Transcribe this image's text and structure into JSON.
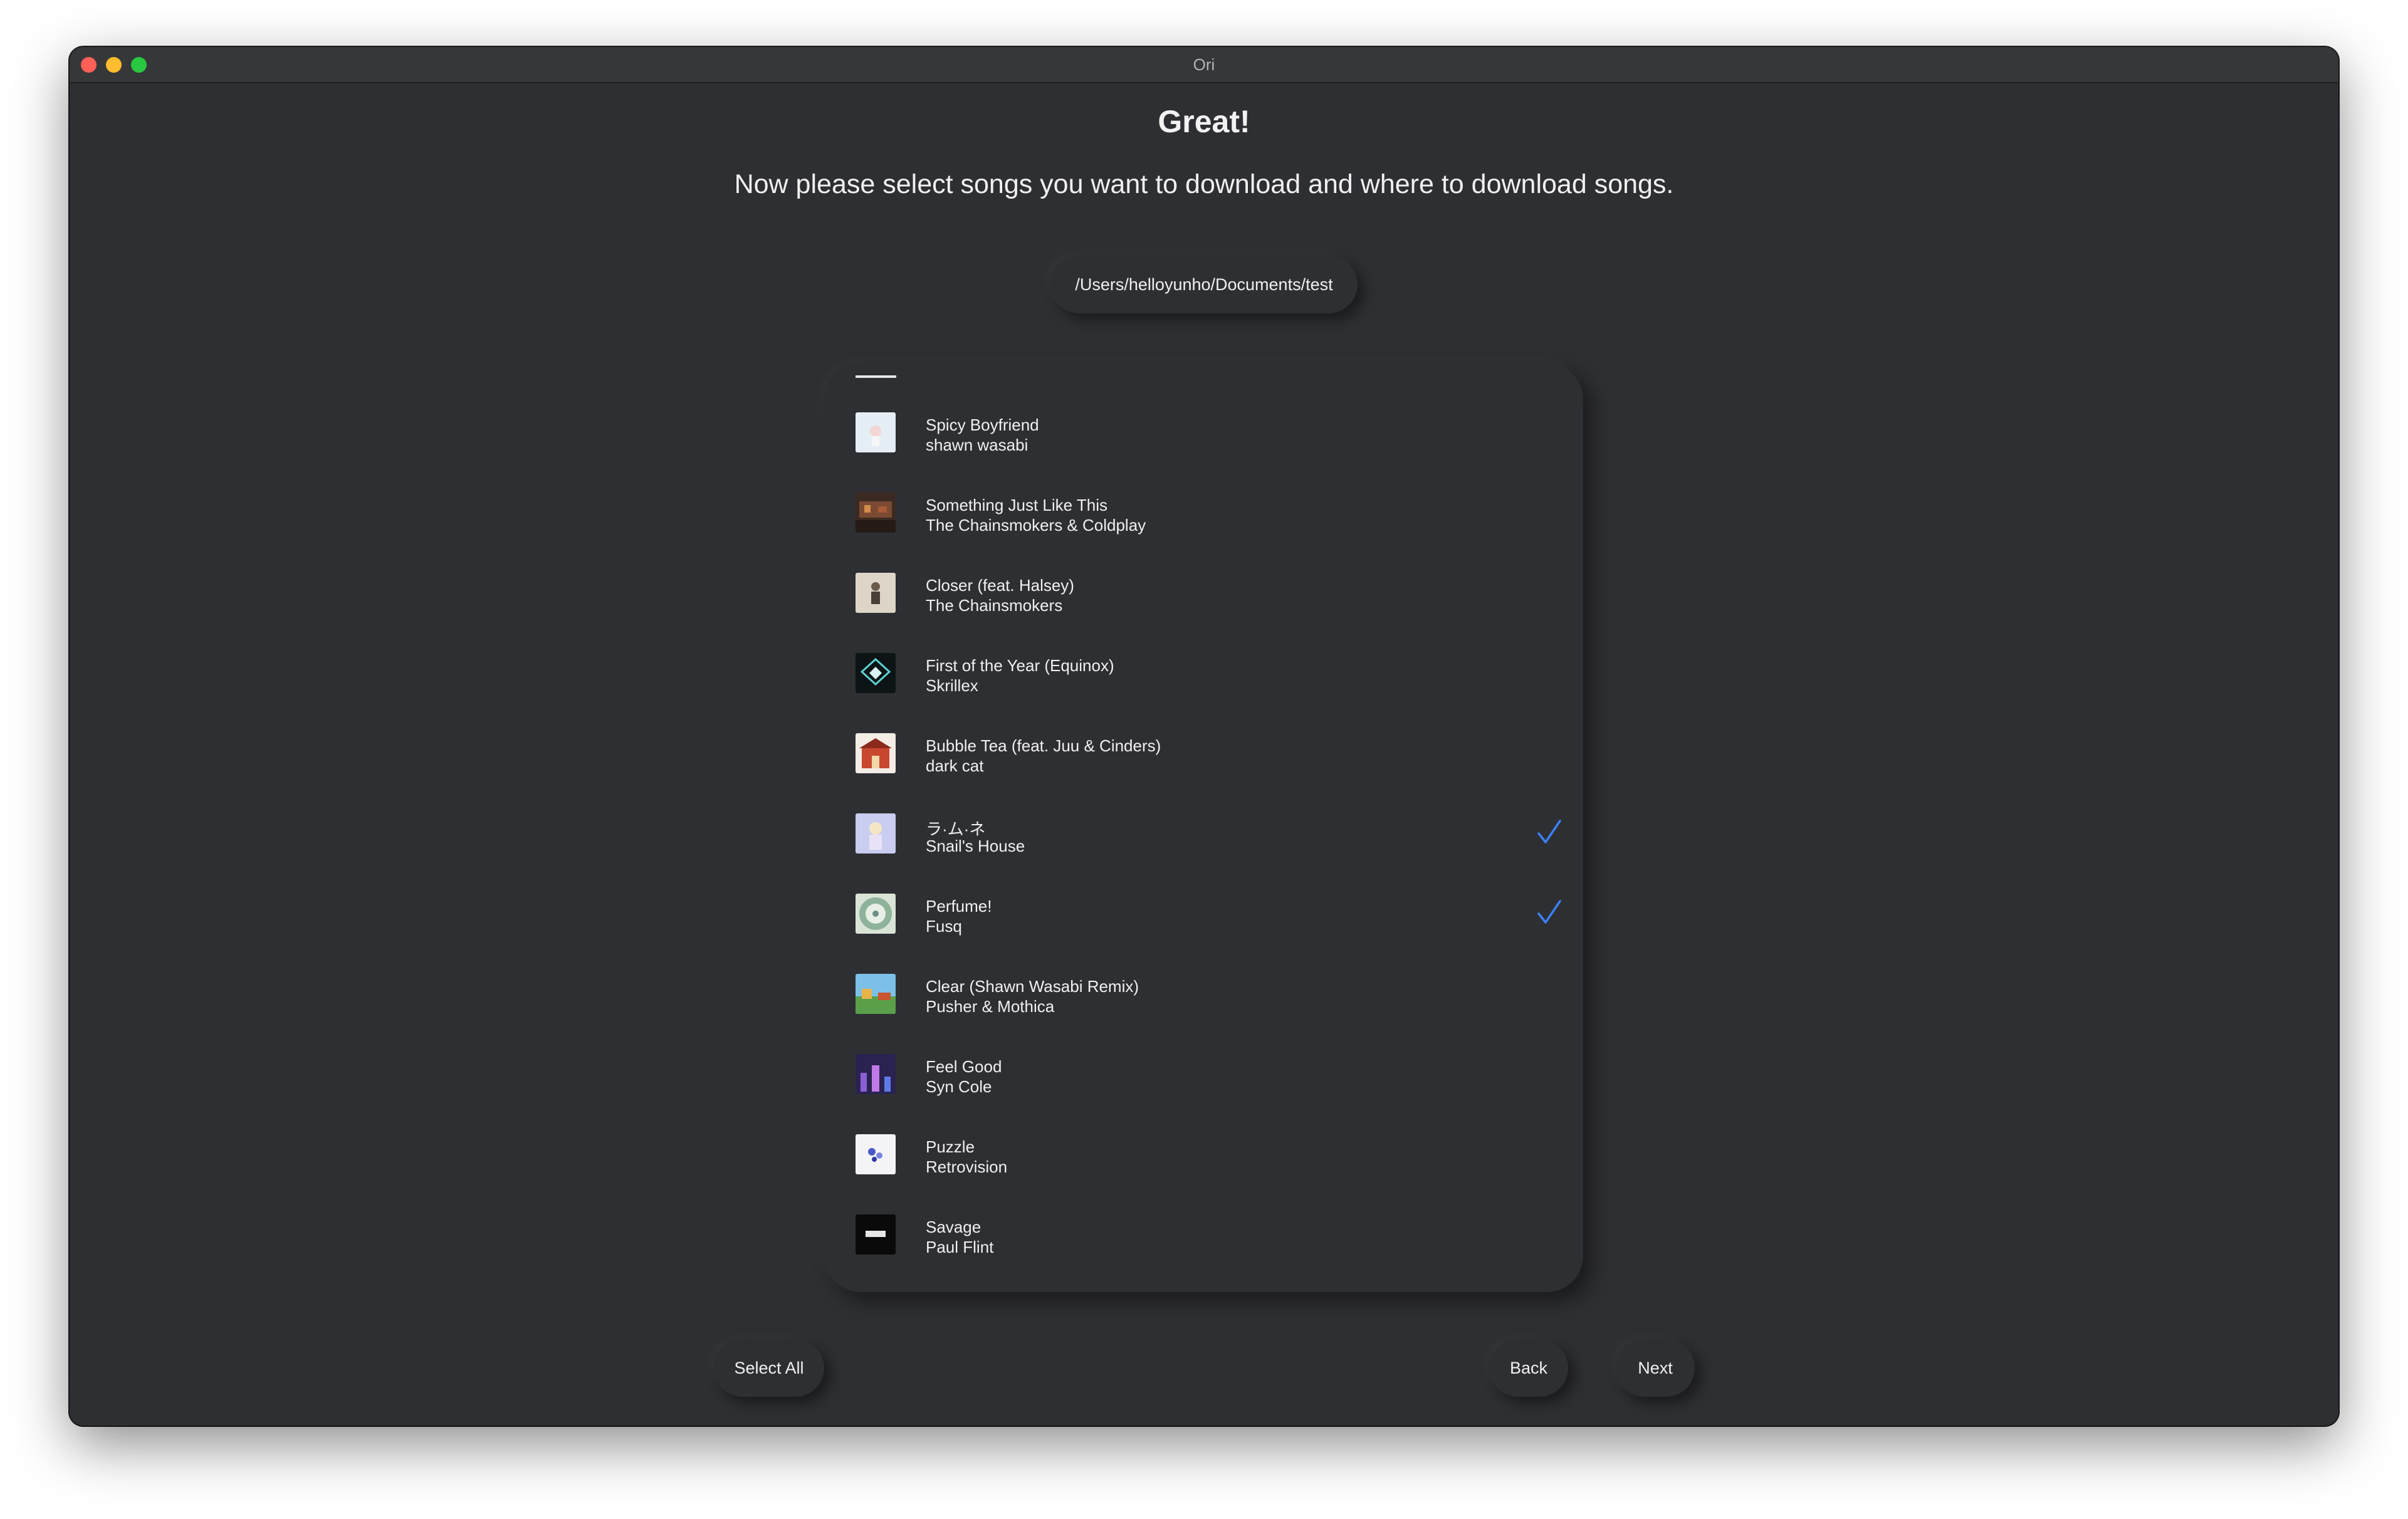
{
  "window": {
    "title": "Ori"
  },
  "heading": "Great!",
  "subheading": "Now please select songs you want to download and where to download songs.",
  "download_path": "/Users/helloyunho/Documents/test",
  "songs": [
    {
      "title": "Spicy Boyfriend",
      "artist": "shawn wasabi",
      "selected": false,
      "art_icon": "album-art-pastel"
    },
    {
      "title": "Something Just Like This",
      "artist": "The Chainsmokers & Coldplay",
      "selected": false,
      "art_icon": "album-art-dark-warm"
    },
    {
      "title": "Closer (feat. Halsey)",
      "artist": "The Chainsmokers",
      "selected": false,
      "art_icon": "album-art-beige"
    },
    {
      "title": "First of the Year (Equinox)",
      "artist": "Skrillex",
      "selected": false,
      "art_icon": "album-art-teal-dark"
    },
    {
      "title": "Bubble Tea (feat. Juu & Cinders)",
      "artist": "dark cat",
      "selected": false,
      "art_icon": "album-art-red-house"
    },
    {
      "title": "ラ·ム·ネ",
      "artist": "Snail's House",
      "selected": true,
      "art_icon": "album-art-lavender"
    },
    {
      "title": "Perfume!",
      "artist": "Fusq",
      "selected": true,
      "art_icon": "album-art-round-green"
    },
    {
      "title": "Clear (Shawn Wasabi Remix)",
      "artist": "Pusher & Mothica",
      "selected": false,
      "art_icon": "album-art-pixel-landscape"
    },
    {
      "title": "Feel Good",
      "artist": "Syn Cole",
      "selected": false,
      "art_icon": "album-art-purple-night"
    },
    {
      "title": "Puzzle",
      "artist": "Retrovision",
      "selected": false,
      "art_icon": "album-art-white-puzzle"
    },
    {
      "title": "Savage",
      "artist": "Paul Flint",
      "selected": false,
      "art_icon": "album-art-black"
    }
  ],
  "buttons": {
    "select_all": "Select All",
    "back": "Back",
    "next": "Next"
  },
  "colors": {
    "background": "#2e2f33",
    "checkmark": "#3b82f6",
    "text": "#f0f0f0"
  }
}
